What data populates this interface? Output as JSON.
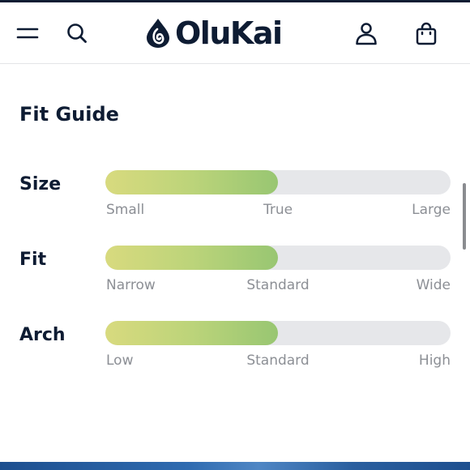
{
  "brand": {
    "name": "OluKai",
    "color": "#0e1c33"
  },
  "header": {
    "menu_icon": "hamburger-menu-icon",
    "search_icon": "search-icon",
    "account_icon": "user-account-icon",
    "cart_icon": "shopping-bag-icon"
  },
  "fit_guide": {
    "title": "Fit Guide",
    "rows": [
      {
        "label": "Size",
        "value_fraction": 0.5,
        "scale": [
          "Small",
          "True",
          "Large"
        ]
      },
      {
        "label": "Fit",
        "value_fraction": 0.5,
        "scale": [
          "Narrow",
          "Standard",
          "Wide"
        ]
      },
      {
        "label": "Arch",
        "value_fraction": 0.5,
        "scale": [
          "Low",
          "Standard",
          "High"
        ]
      }
    ]
  },
  "colors": {
    "track": "#e6e7ea",
    "fill_start": "#d8da7e",
    "fill_end": "#98c672",
    "scale_text": "#8c8f95"
  }
}
